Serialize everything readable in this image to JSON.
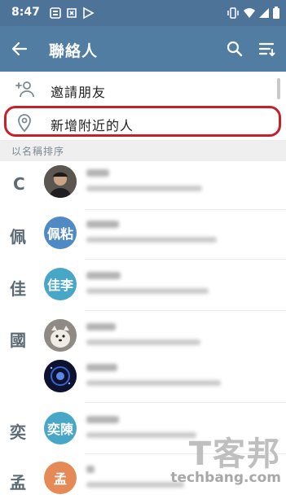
{
  "status_bar": {
    "time": "8:47"
  },
  "app_bar": {
    "title": "聯絡人"
  },
  "actions": [
    {
      "label": "邀請朋友",
      "icon": "add-person-icon"
    },
    {
      "label": "新增附近的人",
      "icon": "location-pin-icon"
    }
  ],
  "section_label": "以名稱排序",
  "index_letters": [
    "C",
    "佩",
    "佳",
    "國",
    "奕",
    "孟"
  ],
  "avatar_labels": [
    "佩粘",
    "佳李",
    "奕陳",
    "孟"
  ],
  "colors": {
    "primary": "#527da3",
    "status": "#4e7399",
    "highlight": "#c8202b"
  },
  "watermark": {
    "text_cn": "T客邦",
    "text_en": "techbang.com"
  }
}
